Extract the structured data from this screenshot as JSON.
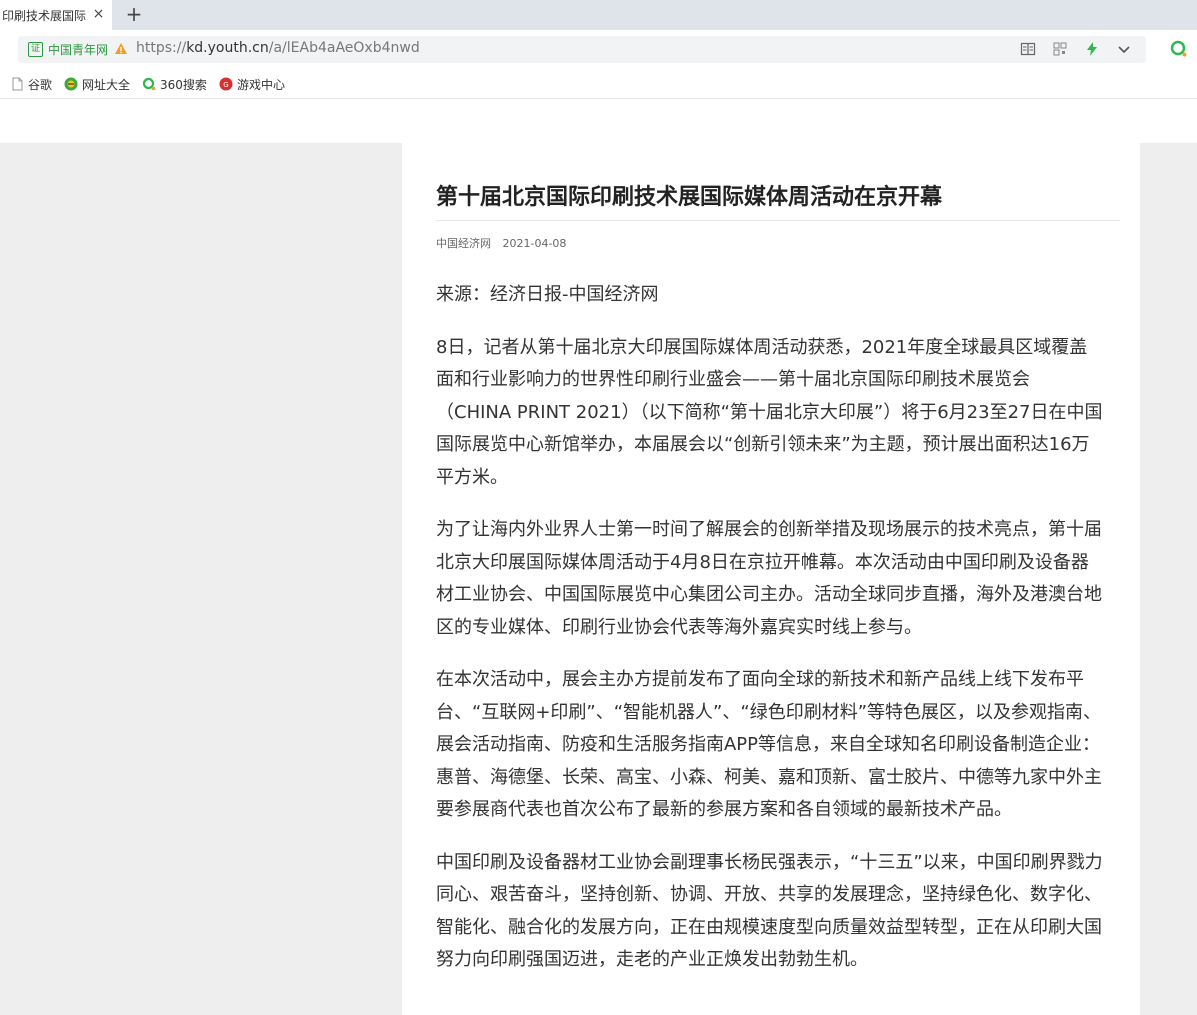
{
  "browser": {
    "tab_title": "印刷技术展国际",
    "tab_close": "×",
    "new_tab": "+",
    "cert_label": "中国青年网",
    "url_proto": "https://",
    "url_host": "kd.youth.cn",
    "url_path": "/a/lEAb4aAeOxb4nwd",
    "bookmarks": [
      {
        "label": "谷歌",
        "icon": "page-icon"
      },
      {
        "label": "网址大全",
        "icon": "globe-icon"
      },
      {
        "label": "360搜索",
        "icon": "search360-icon"
      },
      {
        "label": "游戏中心",
        "icon": "game-icon"
      }
    ],
    "colors": {
      "accent_green": "#2e9a3f",
      "toolbar_bg": "#dfe3ea",
      "page_gutter": "#eeeeee"
    }
  },
  "article": {
    "title": "第十届北京国际印刷技术展国际媒体周活动在京开幕",
    "source": "中国经济网",
    "date": "2021-04-08",
    "paragraphs": [
      "来源：经济日报-中国经济网",
      "8日，记者从第十届北京大印展国际媒体周活动获悉，2021年度全球最具区域覆盖面和行业影响力的世界性印刷行业盛会——第十届北京国际印刷技术展览会（CHINA PRINT 2021）（以下简称“第十届北京大印展”）将于6月23至27日在中国国际展览中心新馆举办，本届展会以“创新引领未来”为主题，预计展出面积达16万平方米。",
      "为了让海内外业界人士第一时间了解展会的创新举措及现场展示的技术亮点，第十届北京大印展国际媒体周活动于4月8日在京拉开帷幕。本次活动由中国印刷及设备器材工业协会、中国国际展览中心集团公司主办。活动全球同步直播，海外及港澳台地区的专业媒体、印刷行业协会代表等海外嘉宾实时线上参与。",
      "在本次活动中，展会主办方提前发布了面向全球的新技术和新产品线上线下发布平台、“互联网+印刷”、“智能机器人”、“绿色印刷材料”等特色展区，以及参观指南、展会活动指南、防疫和生活服务指南APP等信息，来自全球知名印刷设备制造企业：惠普、海德堡、长荣、高宝、小森、柯美、嘉和顶新、富士胶片、中德等九家中外主要参展商代表也首次公布了最新的参展方案和各自领域的最新技术产品。",
      "中国印刷及设备器材工业协会副理事长杨民强表示，“十三五”以来，中国印刷界戮力同心、艰苦奋斗，坚持创新、协调、开放、共享的发展理念，坚持绿色化、数字化、智能化、融合化的发展方向，正在由规模速度型向质量效益型转型，正在从印刷大国努力向印刷强国迈进，走老的产业正焕发出勃勃生机。"
    ]
  }
}
